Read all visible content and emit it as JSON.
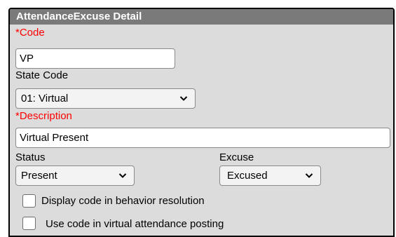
{
  "panel": {
    "title": "AttendanceExcuse Detail"
  },
  "fields": {
    "code": {
      "required_marker": "*",
      "label": "Code",
      "value": "VP"
    },
    "state_code": {
      "label": "State Code",
      "selected": "01: Virtual"
    },
    "description": {
      "required_marker": "*",
      "label": "Description",
      "value": "Virtual Present"
    },
    "status": {
      "label": "Status",
      "selected": "Present"
    },
    "excuse": {
      "label": "Excuse",
      "selected": "Excused"
    }
  },
  "checkboxes": [
    {
      "label": "Display code in behavior resolution",
      "checked": false
    },
    {
      "label": "Use code in virtual attendance posting",
      "checked": false
    }
  ],
  "colors": {
    "header_bg": "#7a7a7a",
    "panel_bg": "#dcdcdc",
    "required_text": "#ff0000"
  }
}
